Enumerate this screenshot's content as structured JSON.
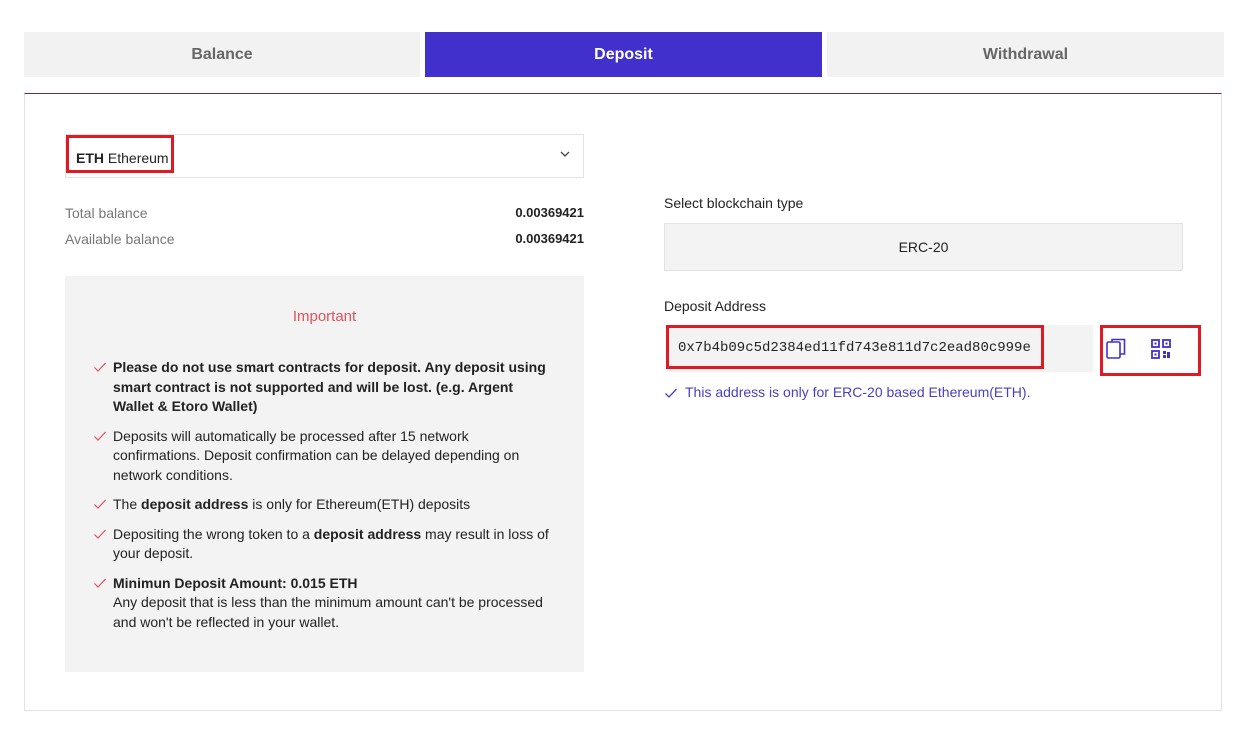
{
  "tabs": [
    {
      "label": "Balance",
      "active": false
    },
    {
      "label": "Deposit",
      "active": true
    },
    {
      "label": "Withdrawal",
      "active": false
    }
  ],
  "currency_select": {
    "symbol": "ETH",
    "name": "Ethereum",
    "icon": "chevron-down-icon"
  },
  "balances": {
    "total": {
      "label": "Total balance",
      "value": "0.00369421"
    },
    "available": {
      "label": "Available balance",
      "value": "0.00369421"
    }
  },
  "important": {
    "title": "Important",
    "notes": [
      {
        "bold": "Please do not use smart contracts for deposit. Any deposit using smart contract is not supported and will be lost. (e.g. Argent Wallet & Etoro Wallet)"
      },
      {
        "text": "Deposits will automatically be processed after 15 network confirmations. Deposit confirmation can be delayed depending on network conditions."
      },
      {
        "pre": "The ",
        "bold": "deposit address",
        "post": " is only for Ethereum(ETH) deposits"
      },
      {
        "pre": "Depositing the wrong token to a ",
        "bold": "deposit address",
        "post": " may result in loss of your deposit."
      },
      {
        "bold": "Minimun Deposit Amount: 0.015 ETH",
        "text": "Any deposit that is less than the minimum amount can't be processed and won't be reflected in your wallet."
      }
    ]
  },
  "blockchain": {
    "label": "Select blockchain type",
    "value": "ERC-20"
  },
  "deposit_address": {
    "label": "Deposit Address",
    "value": "0x7b4b09c5d2384ed11fd743e811d7c2ead80c999e",
    "copy_icon": "copy-icon",
    "qr_icon": "qr-code-icon",
    "note": "This address is only for ERC-20 based Ethereum(ETH)."
  },
  "colors": {
    "accent": "#4230cc",
    "important": "#e0525c",
    "highlight": "#e01a24",
    "note": "#4a3fc0"
  }
}
